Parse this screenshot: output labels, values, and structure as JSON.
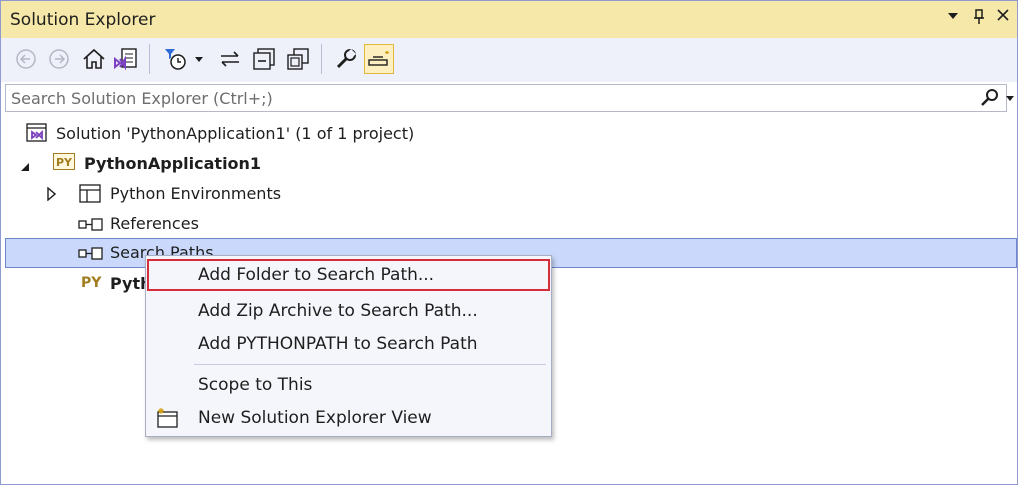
{
  "window": {
    "title": "Solution Explorer",
    "dropdown_glyph": "▾",
    "pin_glyph": "📌",
    "close_glyph": "✕"
  },
  "toolbar": {
    "buttons": [
      "back-icon",
      "forward-icon",
      "home-icon",
      "switch-views-icon",
      "pending-changes-filter-icon",
      "sync-icon",
      "collapse-all-icon",
      "show-all-files-icon",
      "properties-icon",
      "preview-selected-items-icon"
    ]
  },
  "search": {
    "placeholder": "Search Solution Explorer (Ctrl+;)"
  },
  "tree": {
    "solution": "Solution 'PythonApplication1' (1 of 1 project)",
    "project": "PythonApplication1",
    "project_badge": "PY",
    "python_environments": "Python Environments",
    "references": "References",
    "search_paths": "Search Paths",
    "file_badge": "PY",
    "file_partial": "Pyth"
  },
  "context_menu": {
    "add_folder": "Add Folder to Search Path...",
    "add_zip": "Add Zip Archive to Search Path...",
    "add_pythonpath": "Add PYTHONPATH to Search Path",
    "scope_to_this": "Scope to This",
    "new_view": "New Solution Explorer View"
  },
  "colors": {
    "titlebar": "#f6e8a8",
    "toolbar": "#eef0fa",
    "selection": "#c9d8fb",
    "highlight_border": "#d32f3a"
  }
}
